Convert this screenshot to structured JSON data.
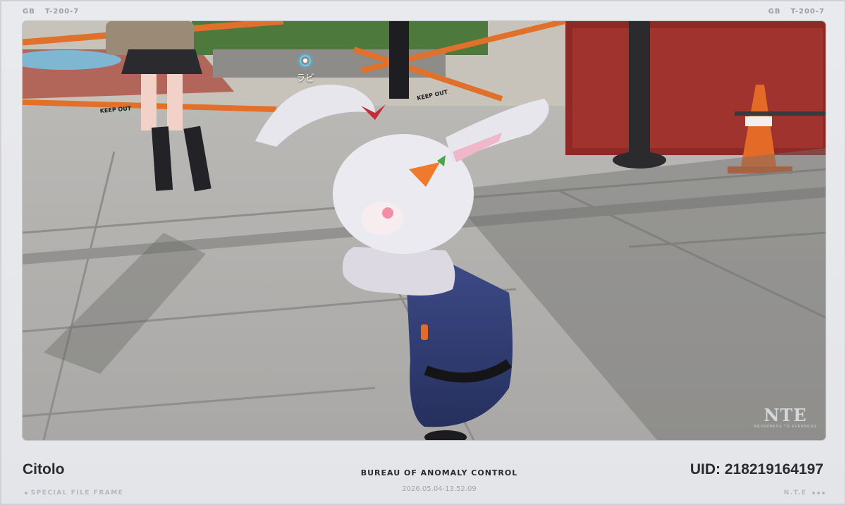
{
  "frame": {
    "top_left": [
      "GB",
      "T-200-7"
    ],
    "top_right": [
      "GB",
      "T-200-7"
    ],
    "footer_left": "SPECIAL FILE FRAME",
    "footer_right": "N.T.E"
  },
  "viewport": {
    "npc_name": "ラビ",
    "tape_text": "KEEP OUT",
    "watermark_logo": "NTE",
    "watermark_sub": "NEVERNESS TO EVERNESS"
  },
  "caption": {
    "player_name": "Citolo",
    "organization": "BUREAU OF ANOMALY CONTROL",
    "timestamp": "2026.05.04-13.52.09",
    "uid": "UID: 218219164197"
  },
  "colors": {
    "frame_bg": "#e7e8ec",
    "text_dark": "#2a2b2f",
    "text_muted": "#a1a4ab",
    "marker": "#5ad6ff",
    "tape_orange": "#e0702a"
  }
}
